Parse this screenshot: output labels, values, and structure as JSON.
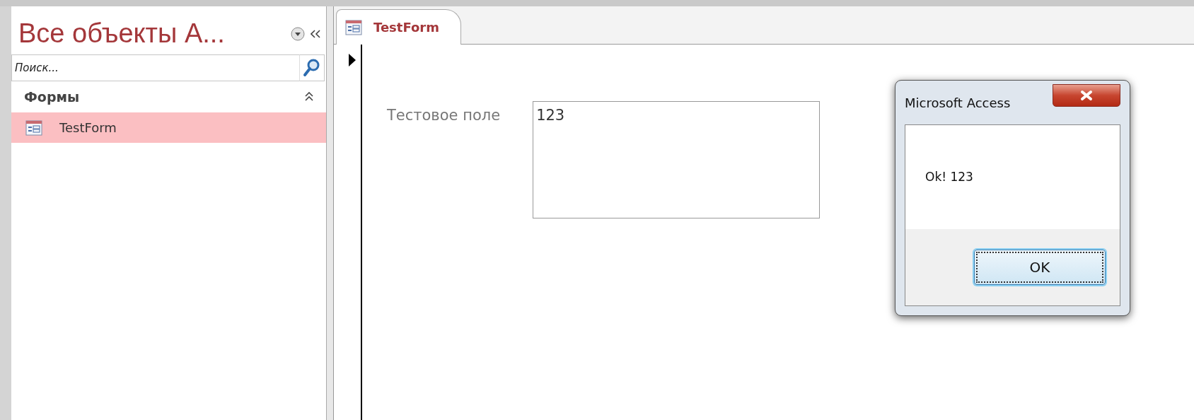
{
  "navigation_pane": {
    "title": "Все объекты A...",
    "search": {
      "placeholder": "Поиск..."
    },
    "groups": [
      {
        "label": "Формы",
        "expanded": true,
        "items": [
          {
            "label": "TestForm",
            "selected": true
          }
        ]
      }
    ]
  },
  "tabs": [
    {
      "label": "TestForm",
      "selected": true
    }
  ],
  "form": {
    "record_selector": true,
    "fields": [
      {
        "label": "Тестовое поле",
        "value": "123"
      }
    ]
  },
  "dialog": {
    "title": "Microsoft Access",
    "message": "Ok! 123",
    "buttons": [
      {
        "label": "OK",
        "focused": true
      }
    ]
  }
}
